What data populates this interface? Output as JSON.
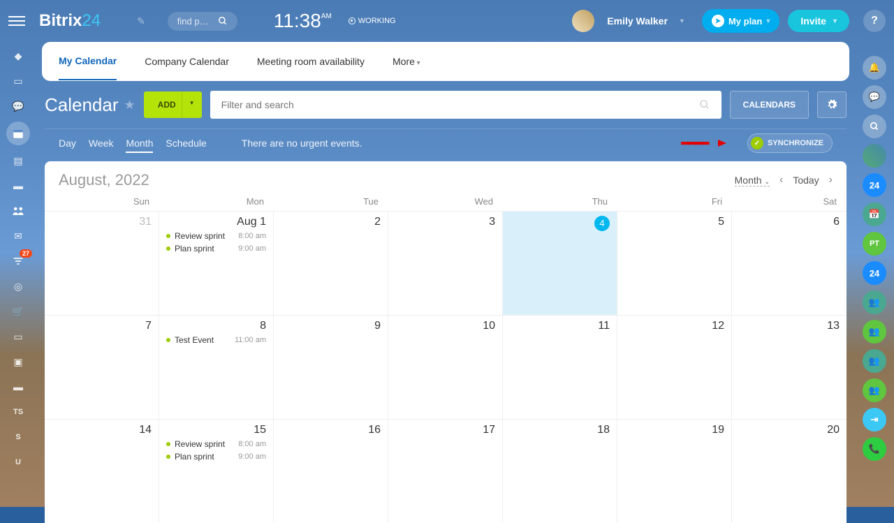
{
  "header": {
    "logo_a": "Bitrix",
    "logo_b": "24",
    "search_placeholder": "find p…",
    "time": "11:38",
    "ampm": "AM",
    "status": "WORKING",
    "user": "Emily Walker",
    "plan": "My plan",
    "invite": "Invite"
  },
  "tabs": [
    "My Calendar",
    "Company Calendar",
    "Meeting room availability",
    "More"
  ],
  "active_tab": 0,
  "toolbar": {
    "title": "Calendar",
    "add": "ADD",
    "filter_placeholder": "Filter and search",
    "calendars": "CALENDARS"
  },
  "viewbar": {
    "views": [
      "Day",
      "Week",
      "Month",
      "Schedule"
    ],
    "active": 2,
    "msg": "There are no urgent events.",
    "sync": "SYNCHRONIZE"
  },
  "calendar": {
    "month_label": "August,",
    "year": "2022",
    "selector": "Month",
    "today": "Today",
    "dow": [
      "Sun",
      "Mon",
      "Tue",
      "Wed",
      "Thu",
      "Fri",
      "Sat"
    ],
    "weeks": [
      [
        {
          "n": "31",
          "muted": true
        },
        {
          "n": "1",
          "prefix": "Aug",
          "events": [
            {
              "t": "Review sprint",
              "tm": "8:00 am"
            },
            {
              "t": "Plan sprint",
              "tm": "9:00 am"
            }
          ]
        },
        {
          "n": "2"
        },
        {
          "n": "3"
        },
        {
          "n": "4",
          "today": true
        },
        {
          "n": "5"
        },
        {
          "n": "6"
        }
      ],
      [
        {
          "n": "7"
        },
        {
          "n": "8",
          "events": [
            {
              "t": "Test Event",
              "tm": "11:00 am"
            }
          ]
        },
        {
          "n": "9"
        },
        {
          "n": "10"
        },
        {
          "n": "11"
        },
        {
          "n": "12"
        },
        {
          "n": "13"
        }
      ],
      [
        {
          "n": "14"
        },
        {
          "n": "15",
          "events": [
            {
              "t": "Review sprint",
              "tm": "8:00 am"
            },
            {
              "t": "Plan sprint",
              "tm": "9:00 am"
            }
          ]
        },
        {
          "n": "16"
        },
        {
          "n": "17"
        },
        {
          "n": "18"
        },
        {
          "n": "19"
        },
        {
          "n": "20"
        }
      ]
    ]
  },
  "left_rail_badge": "27",
  "left_rail_text": [
    "TS",
    "S",
    "U"
  ]
}
